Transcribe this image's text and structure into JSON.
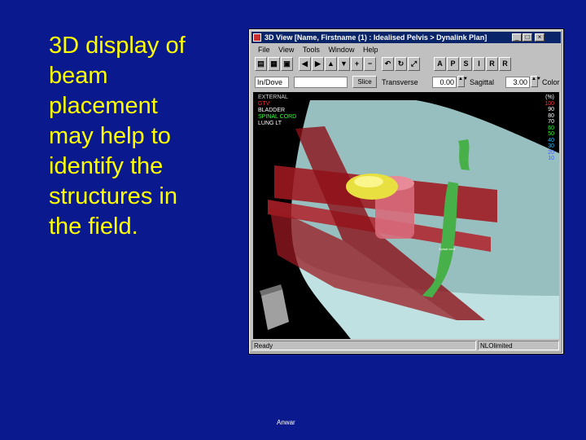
{
  "slide": {
    "lines": [
      "3D display of",
      "beam",
      "placement",
      "may help to",
      "identify the",
      "structures in",
      "the field."
    ],
    "footer": "Anwar"
  },
  "window": {
    "title": "3D View   [Name, Firstname (1) : Idealised Pelvis  > Dynalink Plan]",
    "min_label": "_",
    "max_label": "□",
    "close_label": "×"
  },
  "menu": [
    "File",
    "View",
    "Tools",
    "Window",
    "Help"
  ],
  "toolbar": {
    "icons": [
      "open-icon",
      "print-icon",
      "first-icon",
      "prev-icon",
      "next-icon",
      "up-icon",
      "down-icon",
      "zoom-in-icon",
      "zoom-out-icon",
      "undo-icon",
      "rotate-icon",
      "reset-icon"
    ],
    "view_buttons": [
      "A",
      "P",
      "S",
      "I",
      "R",
      "R"
    ]
  },
  "controls": {
    "mode_value": "In/Dove",
    "dropdown_value": "",
    "slice_label": "Slice",
    "transverse_label": "Transverse",
    "transverse_value": "0.00",
    "sagittal_label": "Sagittal",
    "sagittal_value": "3.00",
    "color_label": "Color"
  },
  "viewport": {
    "structures": [
      {
        "name": "EXTERNAL",
        "color": "#d0d0d0"
      },
      {
        "name": "GTV",
        "color": "#ff3030"
      },
      {
        "name": "BLADDER",
        "color": "#ffffff"
      },
      {
        "name": "SPINAL CORD",
        "color": "#30ff30"
      },
      {
        "name": "LUNG LT",
        "color": "#ffffff"
      }
    ],
    "dose_header": "(%)",
    "dose_levels": [
      {
        "value": "100",
        "color": "#ff3030"
      },
      {
        "value": "90",
        "color": "#ffffff"
      },
      {
        "value": "80",
        "color": "#ffffff"
      },
      {
        "value": "70",
        "color": "#ffffff"
      },
      {
        "value": "60",
        "color": "#30ff30"
      },
      {
        "value": "50",
        "color": "#30ff30"
      },
      {
        "value": "40",
        "color": "#30c0ff"
      },
      {
        "value": "30",
        "color": "#30c0ff"
      },
      {
        "value": "20",
        "color": "#4060ff"
      },
      {
        "value": "10",
        "color": "#4060ff"
      }
    ],
    "cord_annotation": "Spinal cord"
  },
  "status": {
    "left": "Ready",
    "right": "NLOlimited"
  }
}
